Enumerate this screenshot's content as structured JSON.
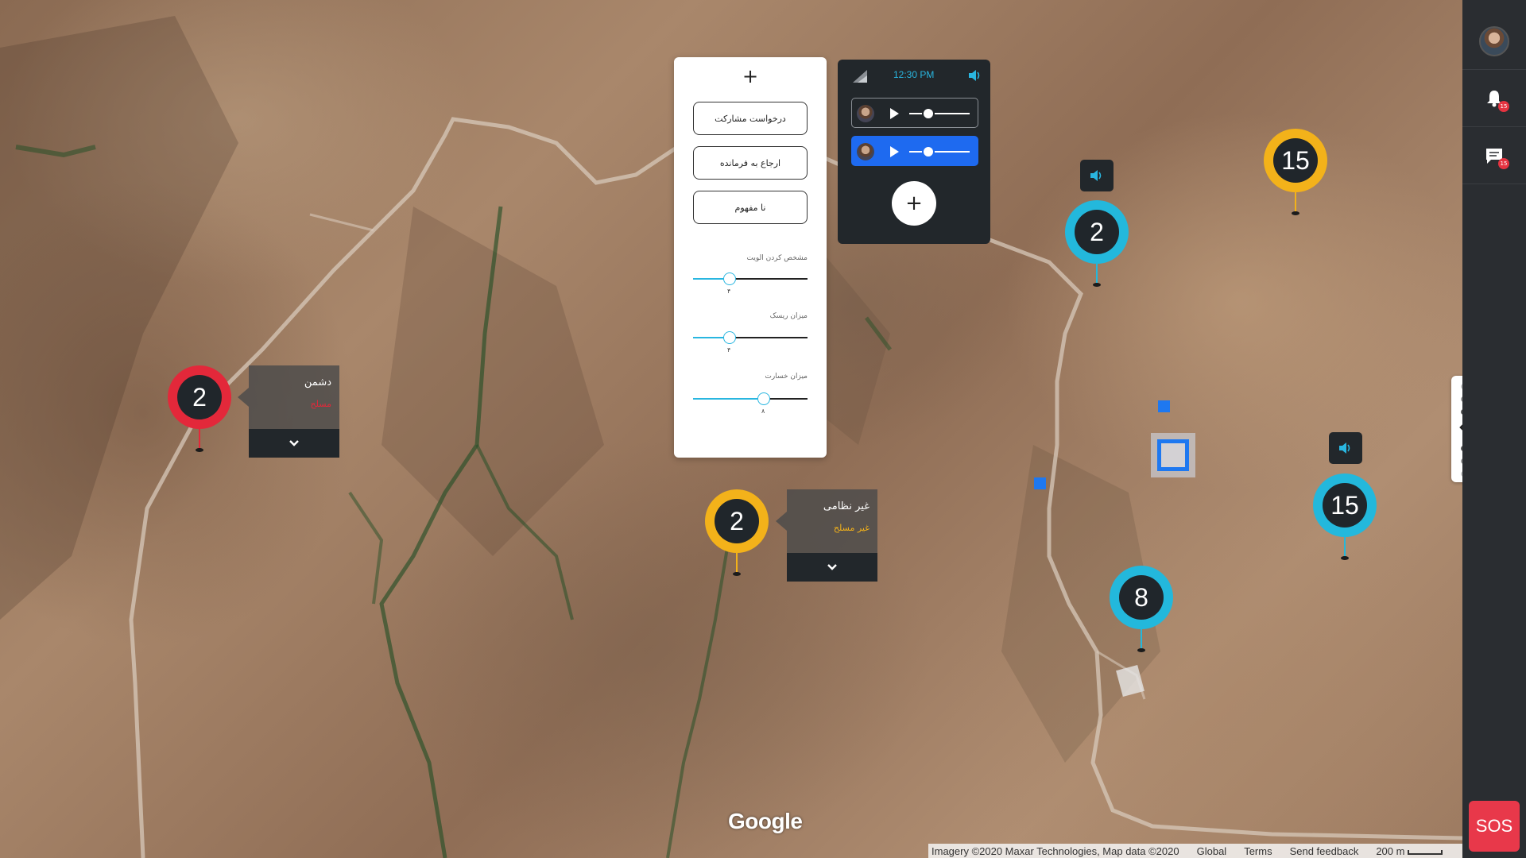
{
  "map": {
    "attribution": "Imagery ©2020 Maxar Technologies, Map data ©2020",
    "region": "Global",
    "terms": "Terms",
    "send_feedback": "Send feedback",
    "scale_label": "200 m",
    "google_logo": "Google"
  },
  "action_panel": {
    "add_symbol": "+",
    "buttons": [
      "درخواست مشارکت",
      "ارجاع به فرمانده",
      "نا مفهوم"
    ],
    "sliders": [
      {
        "label": "مشخص کردن الویت",
        "value_text": "۴",
        "value": 0.32
      },
      {
        "label": "میزان ریسک",
        "value_text": "۴",
        "value": 0.32
      },
      {
        "label": "میزان خسارت",
        "value_text": "۸",
        "value": 0.62
      }
    ]
  },
  "voice_panel": {
    "time": "12:30 PM",
    "add_symbol": "+",
    "tracks": [
      {
        "active": false,
        "progress": 0.2
      },
      {
        "active": true,
        "progress": 0.2
      }
    ]
  },
  "markers": [
    {
      "count": "2",
      "color": "#e3283a",
      "type": "enemy"
    },
    {
      "count": "2",
      "color": "#f3b21a",
      "type": "civil"
    },
    {
      "count": "2",
      "color": "#23b8dc",
      "type": "friendly"
    },
    {
      "count": "15",
      "color": "#f3b21a",
      "type": "civil"
    },
    {
      "count": "15",
      "color": "#23b8dc",
      "type": "friendly"
    },
    {
      "count": "8",
      "color": "#23b8dc",
      "type": "friendly"
    }
  ],
  "tags": {
    "enemy": {
      "title": "دشمن",
      "subtitle": "مسلح",
      "subtitle_color": "#e3283a"
    },
    "civil": {
      "title": "غیر نظامی",
      "subtitle": "غیر مسلح",
      "subtitle_color": "#f3b21a"
    }
  },
  "rail": {
    "notifications_count": "15",
    "messages_count": "15",
    "sos_label": "SOS"
  },
  "colors": {
    "accent": "#29b6e0",
    "primary_blue": "#1e78f0",
    "sos": "#e8384a"
  }
}
